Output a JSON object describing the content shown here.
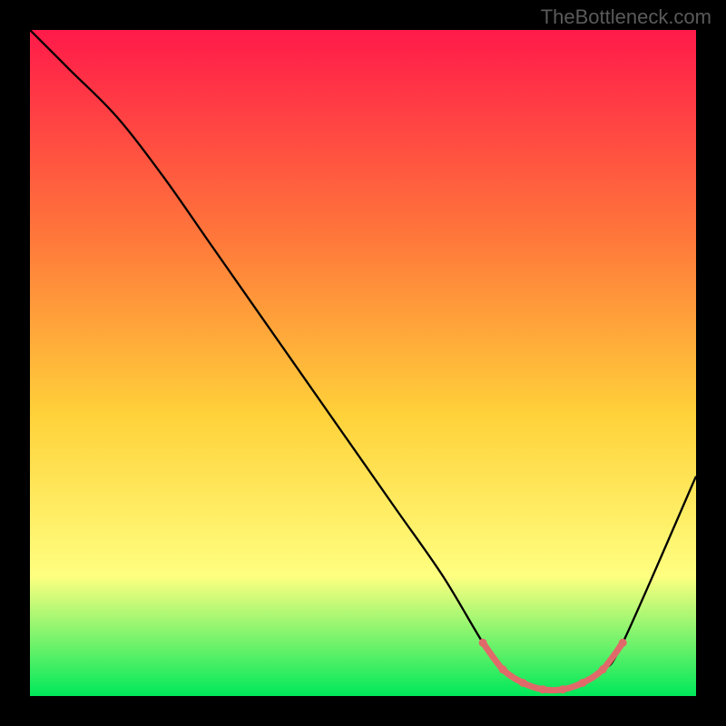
{
  "watermark": "TheBottleneck.com",
  "chart_data": {
    "type": "line",
    "title": "",
    "xlabel": "",
    "ylabel": "",
    "xlim": [
      0,
      100
    ],
    "ylim": [
      0,
      100
    ],
    "background_gradient": {
      "top": "#ff1a4a",
      "mid_upper": "#ff7a3a",
      "mid": "#ffd23a",
      "mid_lower": "#ffff80",
      "bottom": "#00e85a"
    },
    "series": [
      {
        "name": "curve",
        "type": "line",
        "color": "#000000",
        "x": [
          0,
          6,
          13,
          20,
          27,
          34,
          41,
          48,
          55,
          62,
          68,
          71,
          74,
          77,
          80,
          83,
          86,
          89,
          100
        ],
        "y": [
          100,
          94,
          87,
          78,
          68,
          58,
          48,
          38,
          28,
          18,
          8,
          4,
          2,
          1,
          1,
          2,
          4,
          8,
          33
        ]
      },
      {
        "name": "highlight",
        "type": "line",
        "color": "#e06a6a",
        "thick": true,
        "x": [
          68,
          71,
          74,
          77,
          80,
          83,
          86,
          89
        ],
        "y": [
          8,
          4,
          2,
          1,
          1,
          2,
          4,
          8
        ]
      }
    ]
  }
}
